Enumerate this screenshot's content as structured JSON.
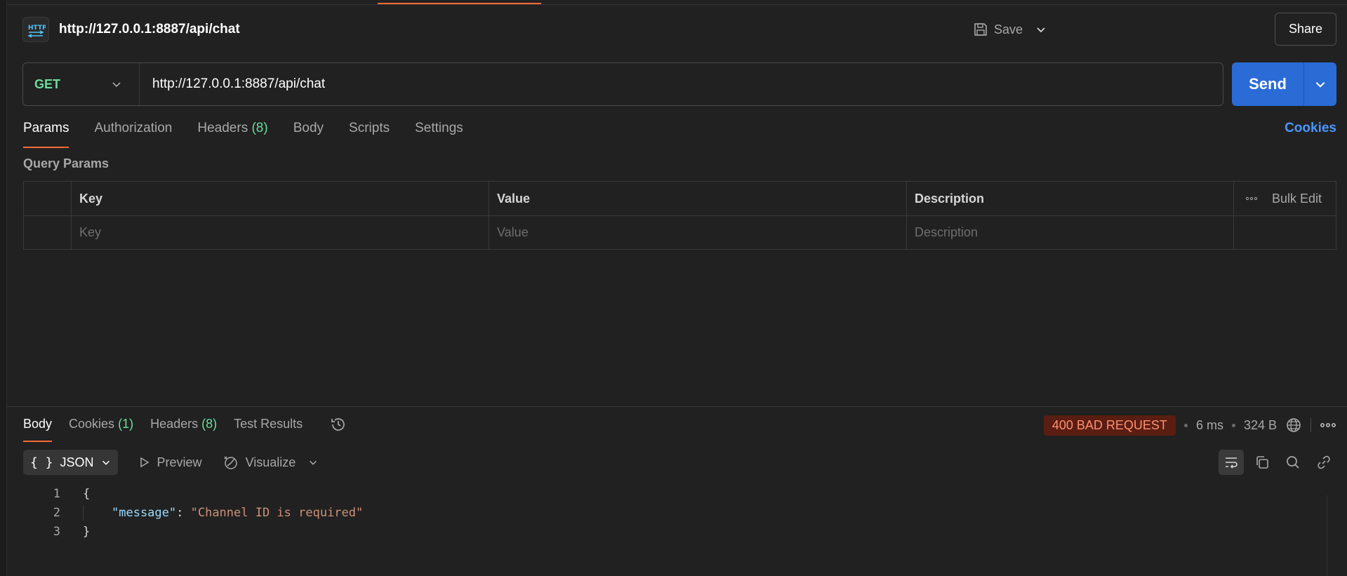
{
  "request": {
    "title": "http://127.0.0.1:8887/api/chat",
    "save_label": "Save",
    "share_label": "Share",
    "method": "GET",
    "url": "http://127.0.0.1:8887/api/chat",
    "send_label": "Send",
    "icon": "http-icon"
  },
  "request_tabs": [
    {
      "label": "Params"
    },
    {
      "label": "Authorization"
    },
    {
      "label": "Headers",
      "count": "(8)"
    },
    {
      "label": "Body"
    },
    {
      "label": "Scripts"
    },
    {
      "label": "Settings"
    }
  ],
  "cookies_link": "Cookies",
  "query_params": {
    "title": "Query Params",
    "columns": [
      "Key",
      "Value",
      "Description"
    ],
    "bulk_edit_label": "Bulk Edit",
    "placeholders": {
      "key": "Key",
      "value": "Value",
      "description": "Description"
    }
  },
  "response_tabs": [
    {
      "label": "Body"
    },
    {
      "label": "Cookies",
      "count": "(1)"
    },
    {
      "label": "Headers",
      "count": "(8)"
    },
    {
      "label": "Test Results"
    }
  ],
  "response": {
    "status": "400 BAD REQUEST",
    "time": "6 ms",
    "size": "324 B",
    "format": "JSON",
    "preview_label": "Preview",
    "visualize_label": "Visualize",
    "code": {
      "line_numbers": [
        "1",
        "2",
        "3"
      ],
      "open_brace": "{",
      "key": "\"message\"",
      "colon": ": ",
      "value": "\"Channel ID is required\"",
      "close_brace": "}"
    }
  },
  "colors": {
    "accent": "#ff6c37",
    "send": "#2a6bd6",
    "method_get": "#6bdd9a",
    "error_badge_bg": "#5a1d12",
    "error_badge_text": "#ff8f70"
  }
}
